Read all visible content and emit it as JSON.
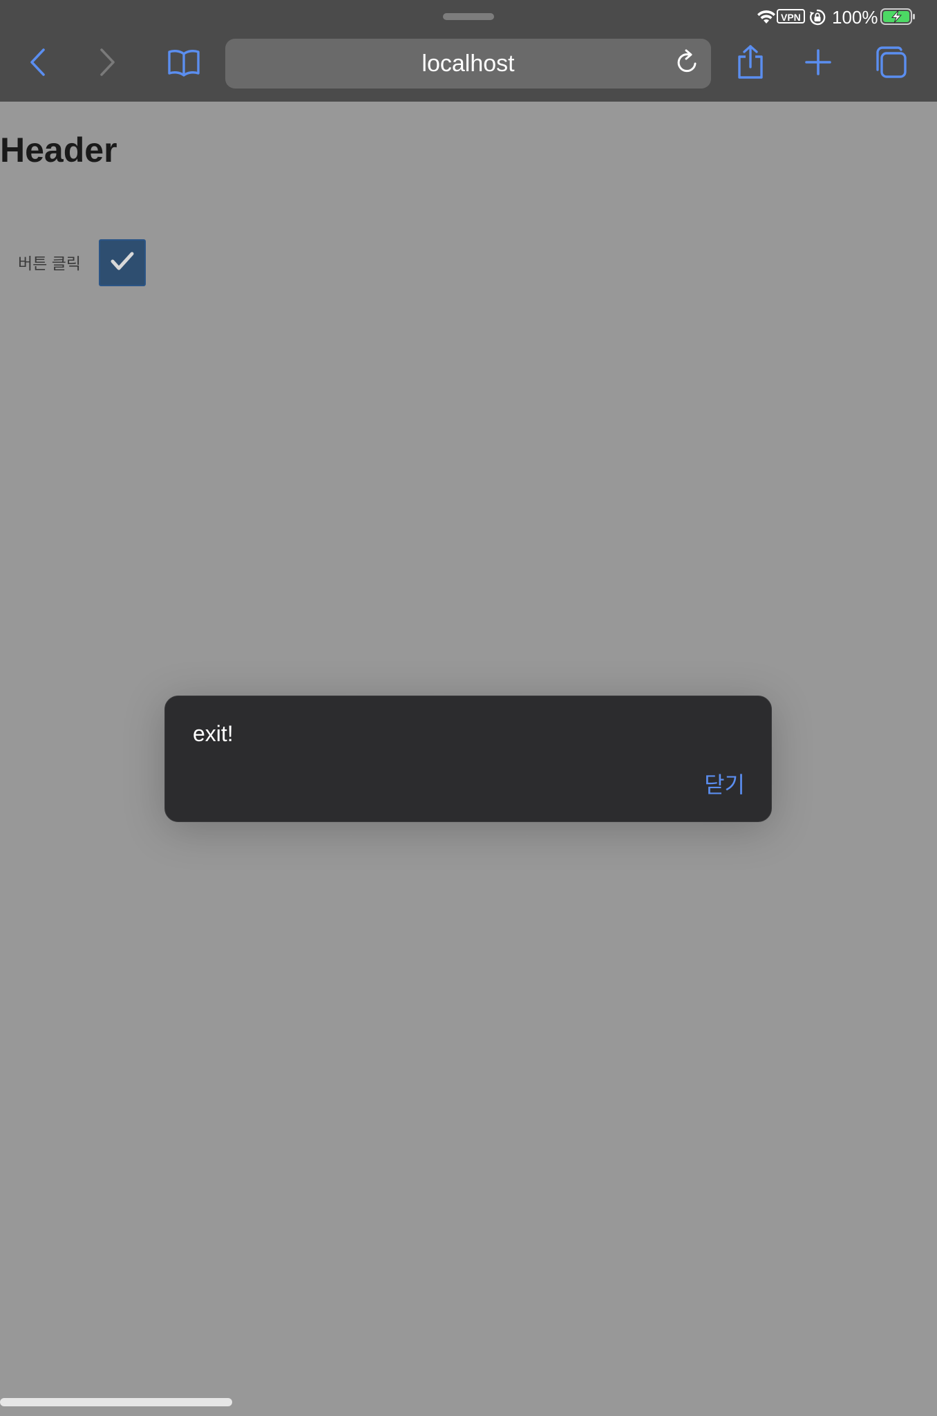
{
  "status_bar": {
    "vpn_label": "VPN",
    "battery_percent": "100%",
    "battery_level": 1.0,
    "icons": [
      "wifi-icon",
      "orientation-lock-icon",
      "battery-charging-icon"
    ]
  },
  "toolbar": {
    "url": "localhost",
    "icons": [
      "back-icon",
      "forward-icon",
      "bookmarks-icon",
      "reload-icon",
      "share-icon",
      "plus-icon",
      "tabs-icon"
    ],
    "accent_color": "#5b8ef0"
  },
  "page": {
    "header": "Header",
    "button_label": "버튼 클릭",
    "checkbox_checked": true
  },
  "alert": {
    "message": "exit!",
    "close_label": "닫기"
  }
}
